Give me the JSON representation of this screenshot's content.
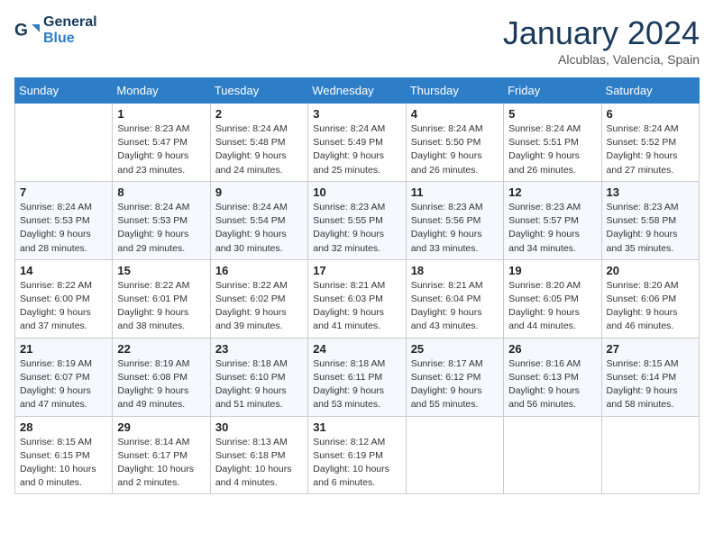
{
  "header": {
    "logo_line1": "General",
    "logo_line2": "Blue",
    "month": "January 2024",
    "location": "Alcublas, Valencia, Spain"
  },
  "weekdays": [
    "Sunday",
    "Monday",
    "Tuesday",
    "Wednesday",
    "Thursday",
    "Friday",
    "Saturday"
  ],
  "weeks": [
    [
      {
        "day": "",
        "info": ""
      },
      {
        "day": "1",
        "info": "Sunrise: 8:23 AM\nSunset: 5:47 PM\nDaylight: 9 hours\nand 23 minutes."
      },
      {
        "day": "2",
        "info": "Sunrise: 8:24 AM\nSunset: 5:48 PM\nDaylight: 9 hours\nand 24 minutes."
      },
      {
        "day": "3",
        "info": "Sunrise: 8:24 AM\nSunset: 5:49 PM\nDaylight: 9 hours\nand 25 minutes."
      },
      {
        "day": "4",
        "info": "Sunrise: 8:24 AM\nSunset: 5:50 PM\nDaylight: 9 hours\nand 26 minutes."
      },
      {
        "day": "5",
        "info": "Sunrise: 8:24 AM\nSunset: 5:51 PM\nDaylight: 9 hours\nand 26 minutes."
      },
      {
        "day": "6",
        "info": "Sunrise: 8:24 AM\nSunset: 5:52 PM\nDaylight: 9 hours\nand 27 minutes."
      }
    ],
    [
      {
        "day": "7",
        "info": "Sunrise: 8:24 AM\nSunset: 5:53 PM\nDaylight: 9 hours\nand 28 minutes."
      },
      {
        "day": "8",
        "info": "Sunrise: 8:24 AM\nSunset: 5:53 PM\nDaylight: 9 hours\nand 29 minutes."
      },
      {
        "day": "9",
        "info": "Sunrise: 8:24 AM\nSunset: 5:54 PM\nDaylight: 9 hours\nand 30 minutes."
      },
      {
        "day": "10",
        "info": "Sunrise: 8:23 AM\nSunset: 5:55 PM\nDaylight: 9 hours\nand 32 minutes."
      },
      {
        "day": "11",
        "info": "Sunrise: 8:23 AM\nSunset: 5:56 PM\nDaylight: 9 hours\nand 33 minutes."
      },
      {
        "day": "12",
        "info": "Sunrise: 8:23 AM\nSunset: 5:57 PM\nDaylight: 9 hours\nand 34 minutes."
      },
      {
        "day": "13",
        "info": "Sunrise: 8:23 AM\nSunset: 5:58 PM\nDaylight: 9 hours\nand 35 minutes."
      }
    ],
    [
      {
        "day": "14",
        "info": "Sunrise: 8:22 AM\nSunset: 6:00 PM\nDaylight: 9 hours\nand 37 minutes."
      },
      {
        "day": "15",
        "info": "Sunrise: 8:22 AM\nSunset: 6:01 PM\nDaylight: 9 hours\nand 38 minutes."
      },
      {
        "day": "16",
        "info": "Sunrise: 8:22 AM\nSunset: 6:02 PM\nDaylight: 9 hours\nand 39 minutes."
      },
      {
        "day": "17",
        "info": "Sunrise: 8:21 AM\nSunset: 6:03 PM\nDaylight: 9 hours\nand 41 minutes."
      },
      {
        "day": "18",
        "info": "Sunrise: 8:21 AM\nSunset: 6:04 PM\nDaylight: 9 hours\nand 43 minutes."
      },
      {
        "day": "19",
        "info": "Sunrise: 8:20 AM\nSunset: 6:05 PM\nDaylight: 9 hours\nand 44 minutes."
      },
      {
        "day": "20",
        "info": "Sunrise: 8:20 AM\nSunset: 6:06 PM\nDaylight: 9 hours\nand 46 minutes."
      }
    ],
    [
      {
        "day": "21",
        "info": "Sunrise: 8:19 AM\nSunset: 6:07 PM\nDaylight: 9 hours\nand 47 minutes."
      },
      {
        "day": "22",
        "info": "Sunrise: 8:19 AM\nSunset: 6:08 PM\nDaylight: 9 hours\nand 49 minutes."
      },
      {
        "day": "23",
        "info": "Sunrise: 8:18 AM\nSunset: 6:10 PM\nDaylight: 9 hours\nand 51 minutes."
      },
      {
        "day": "24",
        "info": "Sunrise: 8:18 AM\nSunset: 6:11 PM\nDaylight: 9 hours\nand 53 minutes."
      },
      {
        "day": "25",
        "info": "Sunrise: 8:17 AM\nSunset: 6:12 PM\nDaylight: 9 hours\nand 55 minutes."
      },
      {
        "day": "26",
        "info": "Sunrise: 8:16 AM\nSunset: 6:13 PM\nDaylight: 9 hours\nand 56 minutes."
      },
      {
        "day": "27",
        "info": "Sunrise: 8:15 AM\nSunset: 6:14 PM\nDaylight: 9 hours\nand 58 minutes."
      }
    ],
    [
      {
        "day": "28",
        "info": "Sunrise: 8:15 AM\nSunset: 6:15 PM\nDaylight: 10 hours\nand 0 minutes."
      },
      {
        "day": "29",
        "info": "Sunrise: 8:14 AM\nSunset: 6:17 PM\nDaylight: 10 hours\nand 2 minutes."
      },
      {
        "day": "30",
        "info": "Sunrise: 8:13 AM\nSunset: 6:18 PM\nDaylight: 10 hours\nand 4 minutes."
      },
      {
        "day": "31",
        "info": "Sunrise: 8:12 AM\nSunset: 6:19 PM\nDaylight: 10 hours\nand 6 minutes."
      },
      {
        "day": "",
        "info": ""
      },
      {
        "day": "",
        "info": ""
      },
      {
        "day": "",
        "info": ""
      }
    ]
  ]
}
